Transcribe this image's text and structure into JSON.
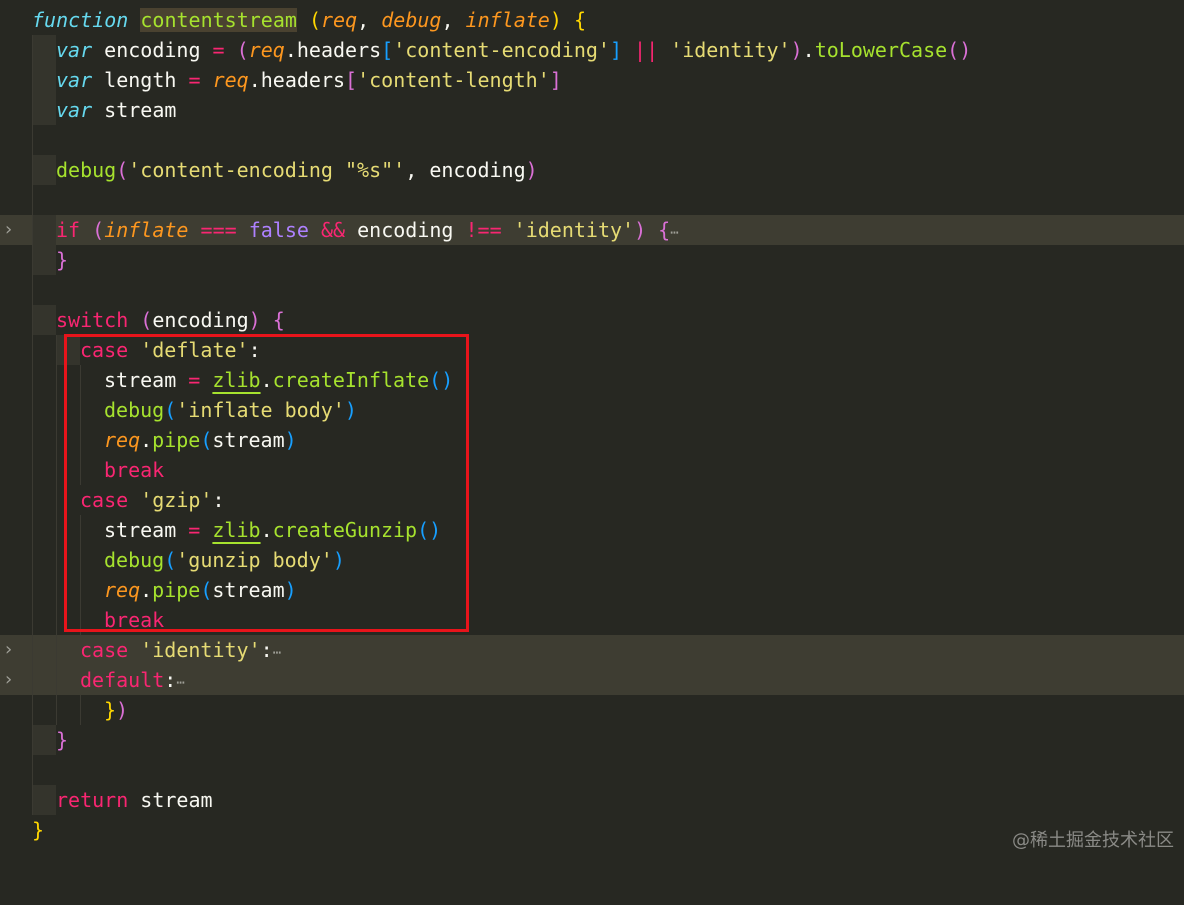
{
  "code": {
    "fn_keyword": "function",
    "fn_name": "contentstream",
    "p_req": "req",
    "p_debug": "debug",
    "p_inflate": "inflate",
    "var_kw": "var",
    "encoding": "encoding",
    "headers": "headers",
    "s_content_encoding": "'content-encoding'",
    "s_identity": "'identity'",
    "toLowerCase": "toLowerCase",
    "length": "length",
    "s_content_length": "'content-length'",
    "stream": "stream",
    "debug": "debug",
    "s_debug_fmt": "'content-encoding \"%s\"'",
    "if_kw": "if",
    "false_kw": "false",
    "switch_kw": "switch",
    "case_kw": "case",
    "s_deflate": "'deflate'",
    "zlib": "zlib",
    "createInflate": "createInflate",
    "s_inflate_body": "'inflate body'",
    "pipe": "pipe",
    "break_kw": "break",
    "s_gzip": "'gzip'",
    "createGunzip": "createGunzip",
    "s_gunzip_body": "'gunzip body'",
    "s_identity_case": "'identity'",
    "default_kw": "default",
    "return_kw": "return"
  },
  "fold_marker": "›",
  "ellipsis": "⋯",
  "watermark": "@稀土掘金技术社区"
}
